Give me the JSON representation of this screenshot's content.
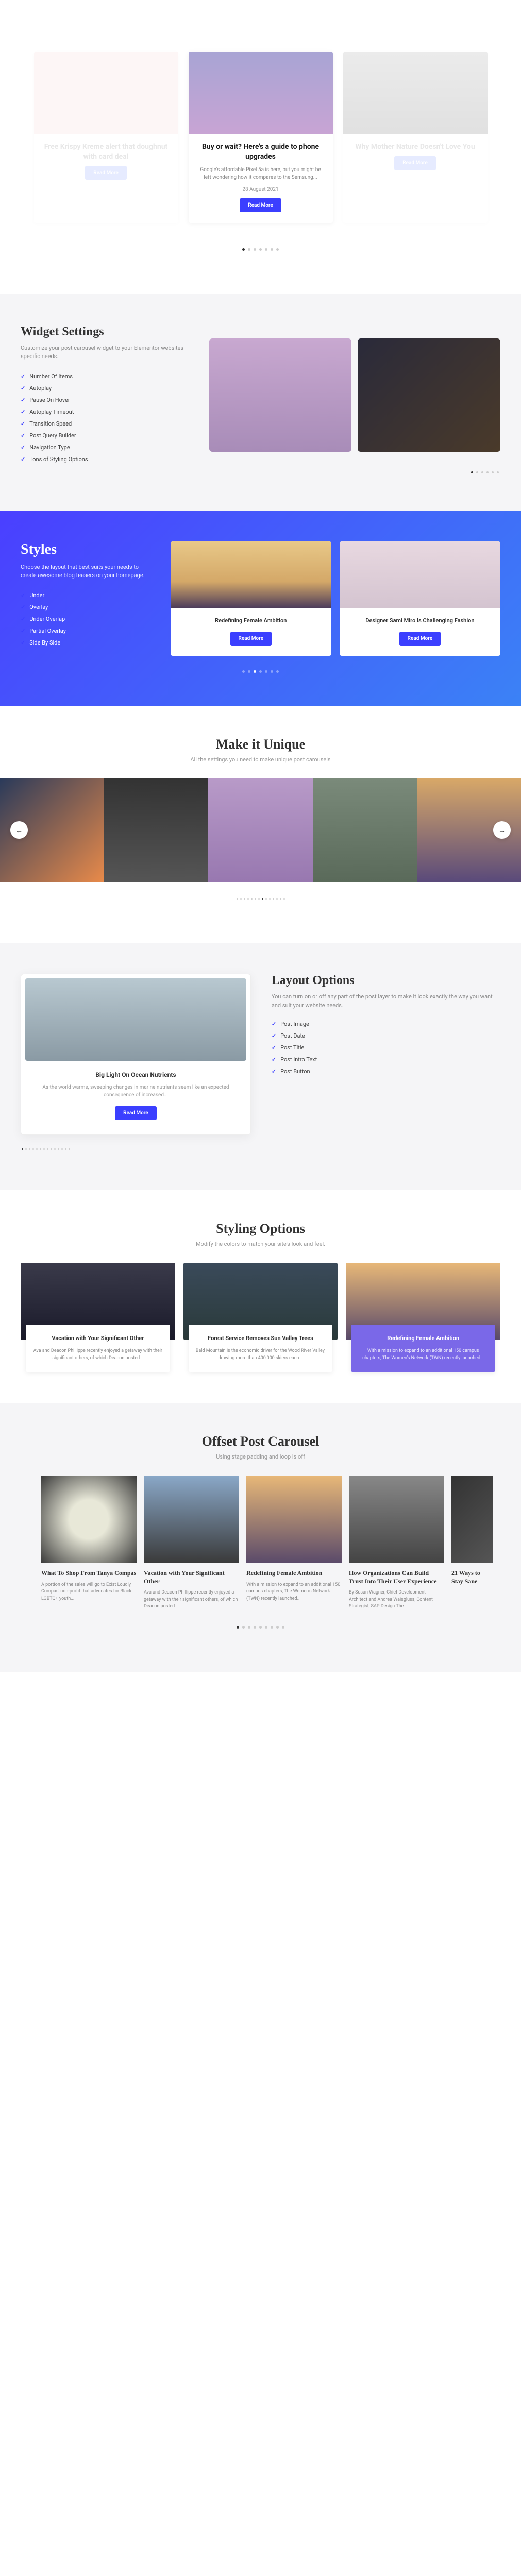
{
  "hero": {
    "cards": [
      {
        "title": "Free Krispy Kreme alert that doughnut with card deal",
        "btn": "Read More"
      },
      {
        "title": "Buy or wait? Here's a guide to phone upgrades",
        "text": "Google's affordable Pixel 5a is here, but you might be left wondering how it compares to the Samsung...",
        "date": "28 August 2021",
        "btn": "Read More"
      },
      {
        "title": "Why Mother Nature Doesn't Love You",
        "btn": "Read More"
      }
    ]
  },
  "widget": {
    "title": "Widget Settings",
    "sub": "Customize your post carousel widget to your Elementor websites specific needs.",
    "items": [
      "Number Of Items",
      "Autoplay",
      "Pause On Hover",
      "Autoplay Timeout",
      "Transition Speed",
      "Post Query Builder",
      "Navigation Type",
      "Tons of Styling Options"
    ]
  },
  "styles": {
    "title": "Styles",
    "sub": "Choose the layout that best suits your needs to create awesome blog teasers on your homepage.",
    "items": [
      "Under",
      "Overlay",
      "Under Overlap",
      "Partial Overlay",
      "Side By Side"
    ],
    "cards": [
      {
        "title": "Redefining Female Ambition",
        "btn": "Read More"
      },
      {
        "title": "Designer Sami Miro Is Challenging Fashion",
        "btn": "Read More"
      }
    ]
  },
  "unique": {
    "title": "Make it Unique",
    "sub": "All the settings you need to make unique post carousels"
  },
  "layout": {
    "card": {
      "title": "Big Light On Ocean Nutrients",
      "text": "As the world warms, sweeping changes in marine nutrients seem like an expected consequence of increased...",
      "btn": "Read More"
    },
    "title": "Layout Options",
    "sub": "You can turn on or off any part of the post layer to make it look exactly the way you want and suit your website needs.",
    "items": [
      "Post Image",
      "Post Date",
      "Post Title",
      "Post Intro Text",
      "Post Button"
    ]
  },
  "styling": {
    "title": "Styling Options",
    "sub": "Modify the colors to match your site's look and feel.",
    "cards": [
      {
        "title": "Vacation with Your Significant Other",
        "text": "Ava and Deacon Phillippe recently enjoyed a getaway with their significant others, of which Deacon posted..."
      },
      {
        "title": "Forest Service Removes Sun Valley Trees",
        "text": "Bald Mountain is the economic driver for the Wood River Valley, drawing more than 400,000 skiers each..."
      },
      {
        "title": "Redefining Female Ambition",
        "text": "With a mission to expand to an additional 150 campus chapters, The Women's Network (TWN) recently launched..."
      }
    ]
  },
  "offset": {
    "title": "Offset Post Carousel",
    "sub": "Using stage padding and loop is off",
    "cards": [
      {
        "title": "What To Shop From Tanya Compas",
        "text": "A portion of the sales will go to Exist Loudly, Compas' non-profit that advocates for Black LGBTQ+ youth..."
      },
      {
        "title": "Vacation with Your Significant Other",
        "text": "Ava and Deacon Phillippe recently enjoyed a getaway with their significant others, of which Deacon posted..."
      },
      {
        "title": "Redefining Female Ambition",
        "text": "With a mission to expand to an additional 150 campus chapters, The Women's Network (TWN) recently launched..."
      },
      {
        "title": "How Organizations Can Build Trust Into Their User Experience",
        "text": "By Susan Wagner, Chief Development Architect and Andrea Waisgluss, Content Strategist, SAP Design The..."
      },
      {
        "title": "21 Ways to Stay Sane",
        "text": ""
      }
    ]
  }
}
